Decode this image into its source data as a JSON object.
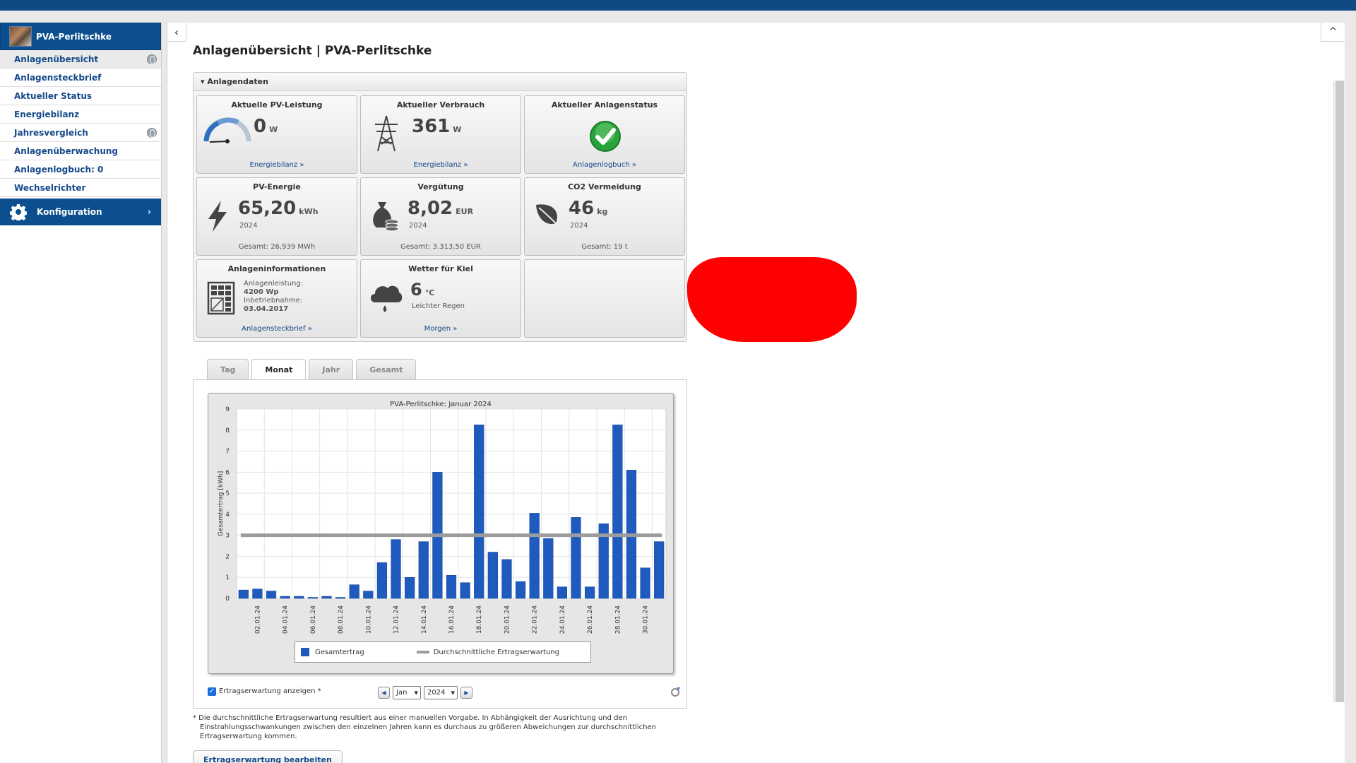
{
  "sidebar": {
    "plant_name": "PVA-Perlitschke",
    "items": [
      {
        "label": "Anlagenübersicht"
      },
      {
        "label": "Anlagensteckbrief"
      },
      {
        "label": "Aktueller Status"
      },
      {
        "label": "Energiebilanz"
      },
      {
        "label": "Jahresvergleich"
      },
      {
        "label": "Anlagenüberwachung"
      },
      {
        "label": "Anlagenlogbuch: 0"
      },
      {
        "label": "Wechselrichter"
      }
    ],
    "config_label": "Konfiguration",
    "config_arrow": "›"
  },
  "page": {
    "title": "Anlagenübersicht | PVA-Perlitschke",
    "collapse_icon": "‹",
    "up_icon": "^"
  },
  "panel": {
    "header": "▾ Anlagendaten",
    "pv_power": {
      "title": "Aktuelle PV-Leistung",
      "value": "0",
      "unit": "W",
      "link": "Energiebilanz »"
    },
    "consumption": {
      "title": "Aktueller Verbrauch",
      "value": "361",
      "unit": "W",
      "link": "Energiebilanz »"
    },
    "status": {
      "title": "Aktueller Anlagenstatus",
      "link": "Anlagenlogbuch »"
    },
    "pv_energy": {
      "title": "PV-Energie",
      "value": "65,20",
      "unit": "kWh",
      "year": "2024",
      "total": "Gesamt: 26,939 MWh"
    },
    "compensation": {
      "title": "Vergütung",
      "value": "8,02",
      "unit": "EUR",
      "year": "2024",
      "total": "Gesamt: 3.313,50 EUR"
    },
    "co2": {
      "title": "CO2 Vermeidung",
      "value": "46",
      "unit": "kg",
      "year": "2024",
      "total": "Gesamt: 19 t"
    },
    "info": {
      "title": "Anlageninformationen",
      "power_label": "Anlagenleistung:",
      "power_value": "4200 Wp",
      "commission_label": "Inbetriebnahme:",
      "commission_value": "03.04.2017",
      "link": "Anlagensteckbrief »"
    },
    "weather": {
      "title": "Wetter für Kiel",
      "value": "6",
      "unit": "°C",
      "desc": "Leichter Regen",
      "link": "Morgen »"
    }
  },
  "tabs": [
    {
      "label": "Tag"
    },
    {
      "label": "Monat"
    },
    {
      "label": "Jahr"
    },
    {
      "label": "Gesamt"
    }
  ],
  "controls": {
    "checkbox_label": "Ertragserwartung anzeigen *",
    "month": "Jan",
    "year": "2024"
  },
  "footnote": {
    "line1": "* Die durchschnittliche Ertragserwartung resultiert aus einer manuellen Vorgabe. In Abhängigkeit der Ausrichtung und den",
    "line2": "Einstrahlungsschwankungen zwischen den einzelnen Jahren kann es durchaus zu größeren Abweichungen zur durchschnittlichen",
    "line3": "Ertragserwartung kommen."
  },
  "edit_button": "Ertragserwartung bearbeiten",
  "colors": {
    "bar": "#1f5bbe",
    "expectation": "#9c9c9c",
    "brand": "#0b4f8e"
  },
  "chart_data": {
    "type": "bar",
    "title": "PVA-Perlitschke: Januar 2024",
    "ylabel": "Gesamtertrag [kWh]",
    "xlabel": "",
    "ylim": [
      0,
      9
    ],
    "yticks": [
      0,
      1,
      2,
      3,
      4,
      5,
      6,
      7,
      8,
      9
    ],
    "categories": [
      "01.01.24",
      "02.01.24",
      "03.01.24",
      "04.01.24",
      "05.01.24",
      "06.01.24",
      "07.01.24",
      "08.01.24",
      "09.01.24",
      "10.01.24",
      "11.01.24",
      "12.01.24",
      "13.01.24",
      "14.01.24",
      "15.01.24",
      "16.01.24",
      "17.01.24",
      "18.01.24",
      "19.01.24",
      "20.01.24",
      "21.01.24",
      "22.01.24",
      "23.01.24",
      "24.01.24",
      "25.01.24",
      "26.01.24",
      "27.01.24",
      "28.01.24",
      "29.01.24",
      "30.01.24",
      "31.01.24"
    ],
    "tick_labels": [
      "02.01.24",
      "04.01.24",
      "06.01.24",
      "08.01.24",
      "10.01.24",
      "12.01.24",
      "14.01.24",
      "16.01.24",
      "18.01.24",
      "20.01.24",
      "22.01.24",
      "24.01.24",
      "26.01.24",
      "28.01.24",
      "30.01.24"
    ],
    "series": [
      {
        "name": "Gesamtertrag",
        "type": "bar",
        "values": [
          0.4,
          0.45,
          0.35,
          0.1,
          0.1,
          0.05,
          0.1,
          0.05,
          0.65,
          0.35,
          1.7,
          2.8,
          1.0,
          2.7,
          6.0,
          1.1,
          0.75,
          8.25,
          2.2,
          1.85,
          0.8,
          4.05,
          2.85,
          0.55,
          3.85,
          0.55,
          3.55,
          8.25,
          6.1,
          1.45,
          2.7
        ]
      },
      {
        "name": "Durchschnittliche Ertragserwartung",
        "type": "line",
        "value": 3.0
      }
    ],
    "grid": true,
    "legend": "bottom"
  }
}
